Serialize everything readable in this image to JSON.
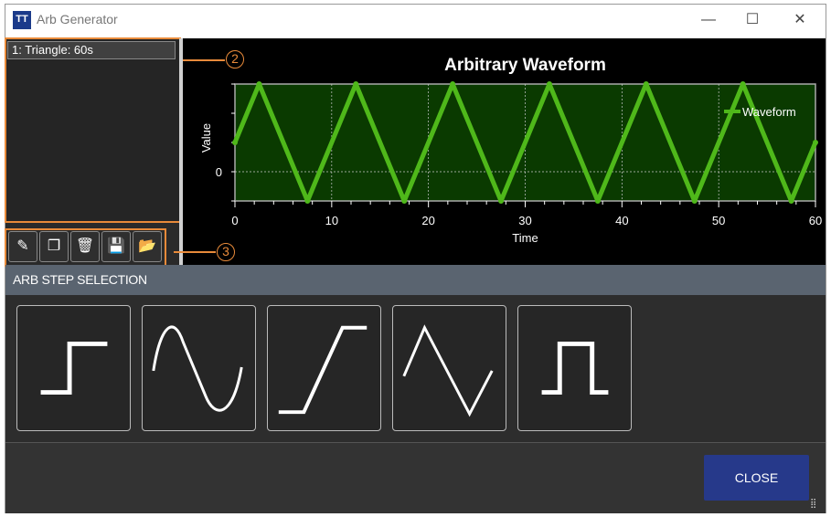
{
  "window": {
    "title": "Arb Generator",
    "icon_text": "TT",
    "minimize": "—",
    "maximize": "☐",
    "close": "✕"
  },
  "steps_list": {
    "items": [
      {
        "label": "1: Triangle: 60s"
      }
    ]
  },
  "toolbar": {
    "buttons": [
      {
        "name": "edit",
        "icon": "edit-icon"
      },
      {
        "name": "copy",
        "icon": "copy-icon"
      },
      {
        "name": "delete",
        "icon": "trash-icon"
      },
      {
        "name": "save",
        "icon": "save-icon"
      },
      {
        "name": "open",
        "icon": "folder-open-icon"
      }
    ]
  },
  "annotations": {
    "a2": "2",
    "a3": "3"
  },
  "chart_data": {
    "type": "line",
    "title": "Arbitrary Waveform",
    "xlabel": "Time",
    "ylabel": "Value",
    "xlim": [
      0,
      60
    ],
    "ylim": [
      -1,
      3
    ],
    "xticks": [
      0,
      10,
      20,
      30,
      40,
      50,
      60
    ],
    "yticks_labeled": [
      0
    ],
    "grid": true,
    "legend": {
      "entries": [
        "Waveform"
      ],
      "placement": "top-right"
    },
    "series": [
      {
        "name": "Waveform",
        "color": "#4fb81a",
        "x": [
          0,
          2.5,
          7.5,
          12.5,
          17.5,
          22.5,
          27.5,
          32.5,
          37.5,
          42.5,
          47.5,
          52.5,
          57.5,
          60
        ],
        "y": [
          1,
          3,
          -1,
          3,
          -1,
          3,
          -1,
          3,
          -1,
          3,
          -1,
          3,
          -1,
          1
        ]
      }
    ],
    "plot_bg": "#0a3a00"
  },
  "step_selection": {
    "header": "ARB STEP SELECTION",
    "options": [
      "step",
      "sine",
      "ramp",
      "triangle",
      "pulse"
    ]
  },
  "close_label": "CLOSE"
}
